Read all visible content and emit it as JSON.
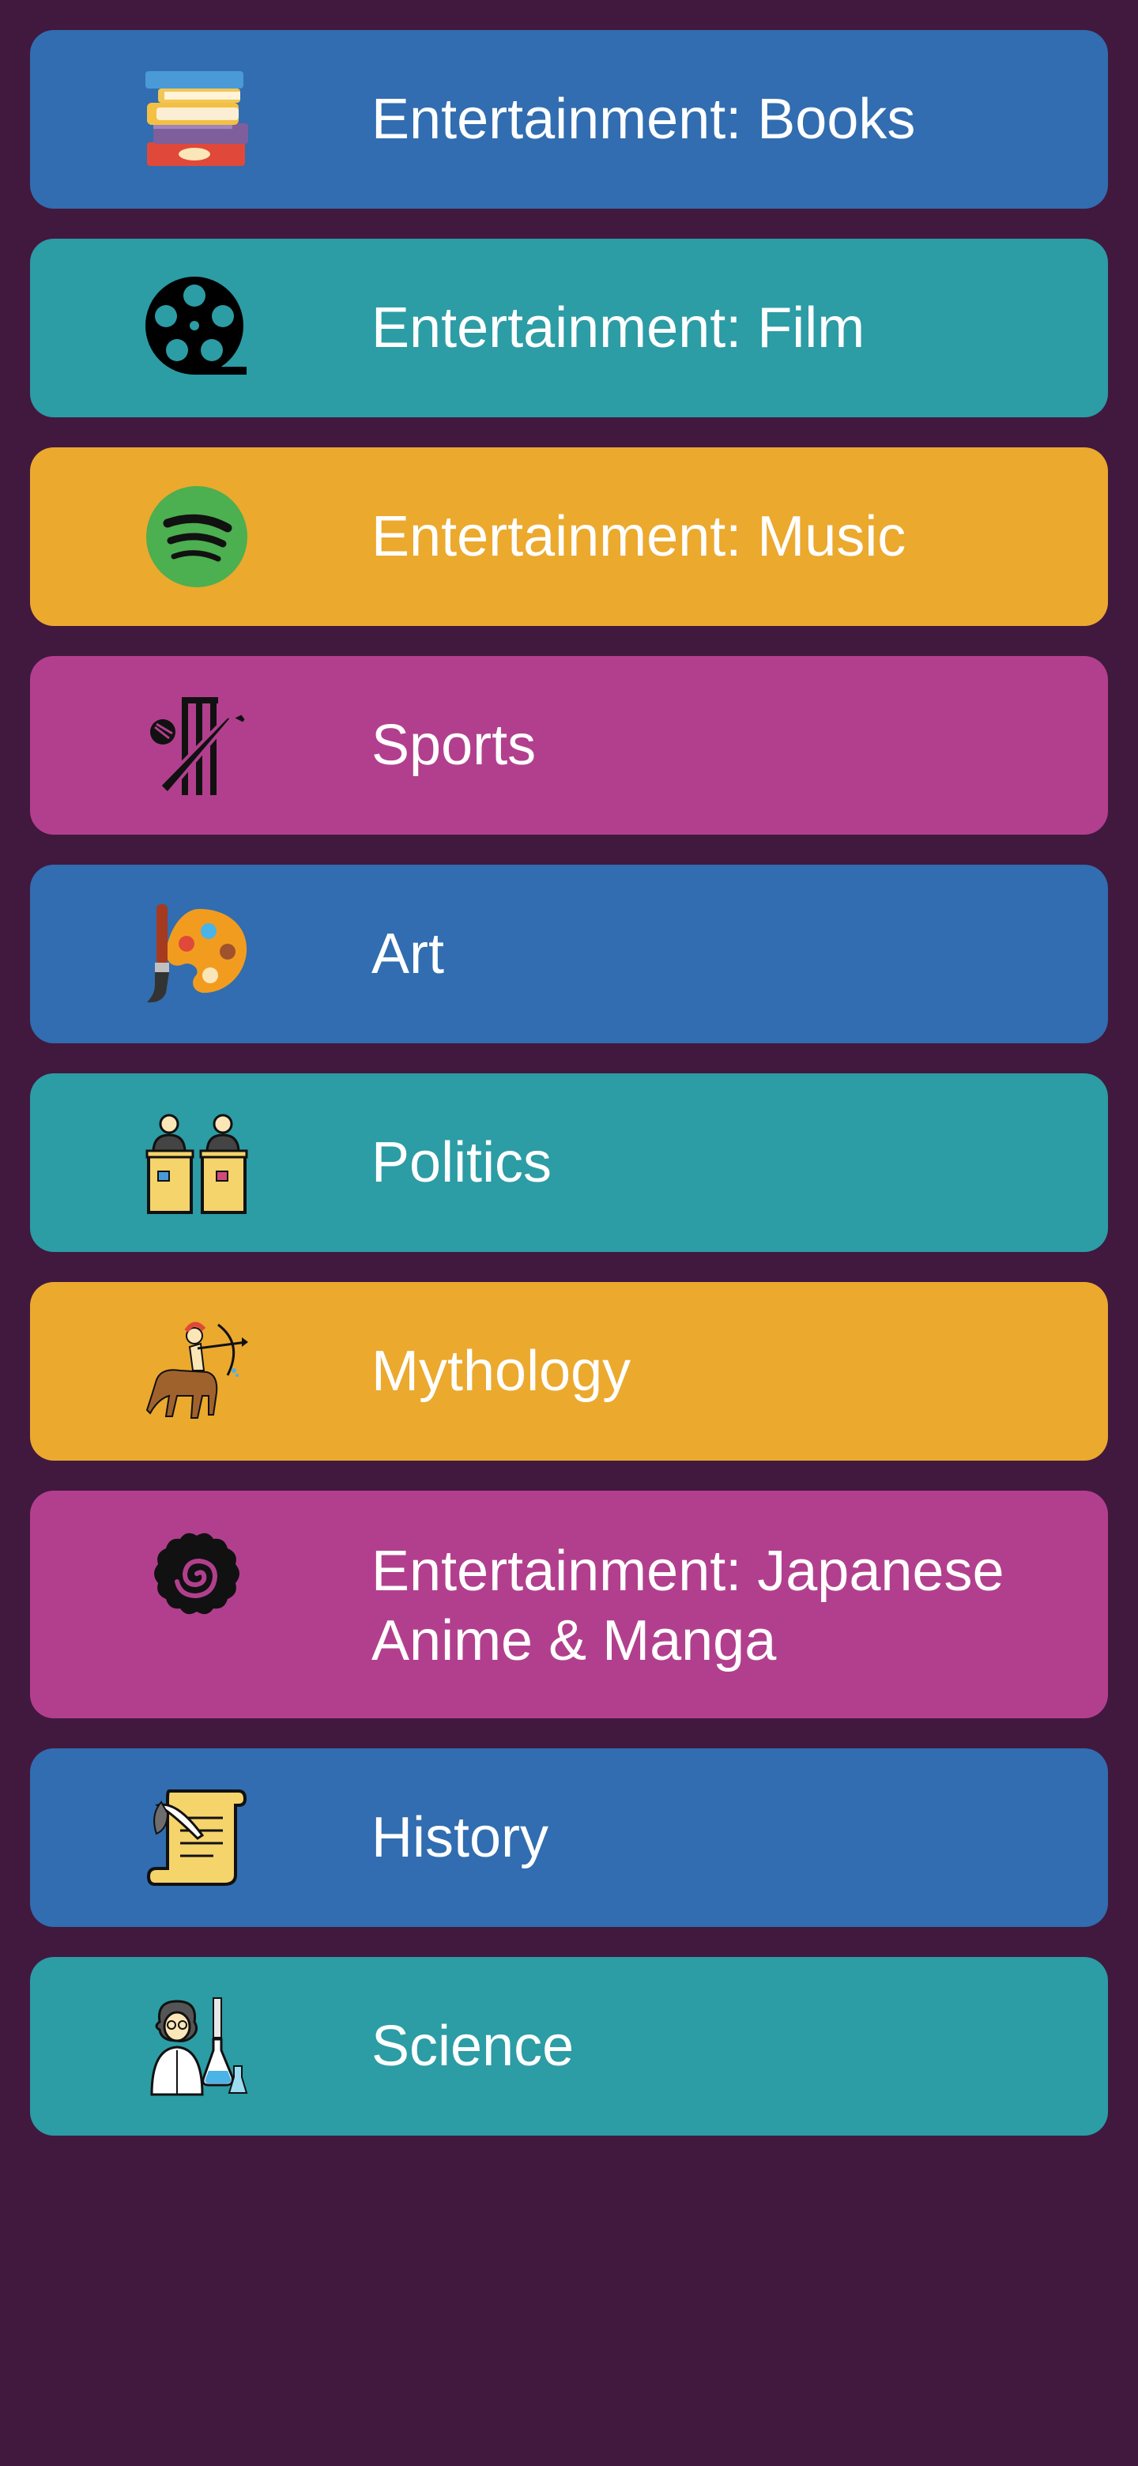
{
  "categories": [
    {
      "label": "Entertainment: Books",
      "icon": "books-icon",
      "color": "#316db0"
    },
    {
      "label": "Entertainment: Film",
      "icon": "film-reel-icon",
      "color": "#2c9ca5"
    },
    {
      "label": "Entertainment: Music",
      "icon": "spotify-icon",
      "color": "#eba92e"
    },
    {
      "label": "Sports",
      "icon": "cricket-icon",
      "color": "#b23f8e"
    },
    {
      "label": "Art",
      "icon": "paint-palette-icon",
      "color": "#316db0"
    },
    {
      "label": "Politics",
      "icon": "politicians-podium-icon",
      "color": "#2c9ca5"
    },
    {
      "label": "Mythology",
      "icon": "centaur-archer-icon",
      "color": "#eba92e"
    },
    {
      "label": "Entertainment: Japanese Anime & Manga",
      "icon": "spiral-flower-icon",
      "color": "#b23f8e"
    },
    {
      "label": "History",
      "icon": "scroll-quill-icon",
      "color": "#316db0"
    },
    {
      "label": "Science",
      "icon": "scientist-icon",
      "color": "#2c9ca5"
    }
  ],
  "colors": {
    "background": "#41193e",
    "blue": "#316db0",
    "teal": "#2c9ca5",
    "gold": "#eba92e",
    "pink": "#b23f8e"
  }
}
